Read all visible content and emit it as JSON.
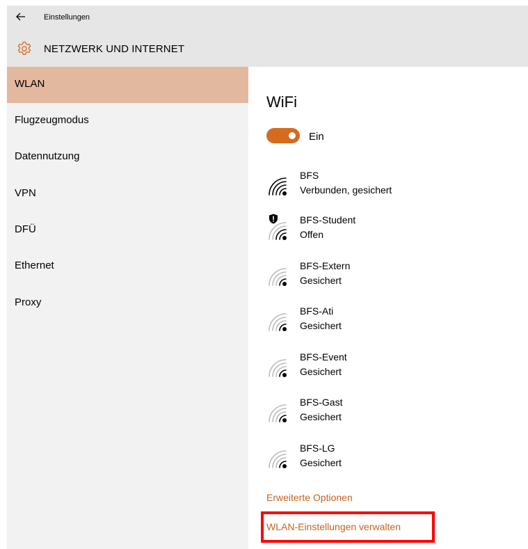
{
  "window": {
    "title": "Einstellungen"
  },
  "header": {
    "title": "NETZWERK UND INTERNET",
    "icon": "gear-icon"
  },
  "sidebar": {
    "items": [
      {
        "label": "WLAN",
        "active": true
      },
      {
        "label": "Flugzeugmodus",
        "active": false
      },
      {
        "label": "Datennutzung",
        "active": false
      },
      {
        "label": "VPN",
        "active": false
      },
      {
        "label": "DFÜ",
        "active": false
      },
      {
        "label": "Ethernet",
        "active": false
      },
      {
        "label": "Proxy",
        "active": false
      }
    ]
  },
  "main": {
    "heading": "WiFi",
    "toggle": {
      "label": "Ein",
      "on": true
    },
    "networks": [
      {
        "ssid": "BFS",
        "status": "Verbunden, gesichert",
        "icon": "wifi-signal-icon"
      },
      {
        "ssid": "BFS-Student",
        "status": "Offen",
        "icon": "wifi-signal-shield-icon"
      },
      {
        "ssid": "BFS-Extern",
        "status": "Gesichert",
        "icon": "wifi-signal-icon"
      },
      {
        "ssid": "BFS-Ati",
        "status": "Gesichert",
        "icon": "wifi-signal-icon"
      },
      {
        "ssid": "BFS-Event",
        "status": "Gesichert",
        "icon": "wifi-signal-icon"
      },
      {
        "ssid": "BFS-Gast",
        "status": "Gesichert",
        "icon": "wifi-signal-icon"
      },
      {
        "ssid": "BFS-LG",
        "status": "Gesichert",
        "icon": "wifi-signal-icon"
      }
    ],
    "links": {
      "advanced": "Erweiterte Optionen",
      "manage": "WLAN-Einstellungen verwalten"
    }
  },
  "colors": {
    "accent": "#d56b1f",
    "link": "#c9631d",
    "active_nav": "#e2b99e",
    "highlight": "#ff0000"
  }
}
